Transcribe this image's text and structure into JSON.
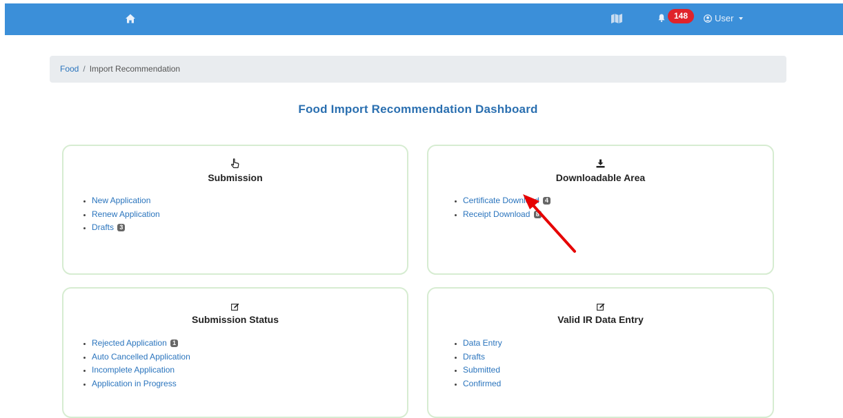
{
  "topbar": {
    "notification_count": "148",
    "user_label": "User",
    "bg_color": "#3b8fd9",
    "badge_color": "#e0232b"
  },
  "breadcrumb": {
    "root": "Food",
    "separator": "/",
    "current": "Import Recommendation"
  },
  "page": {
    "title": "Food Import Recommendation Dashboard"
  },
  "cards": {
    "submission": {
      "icon": "hand-pointer-icon",
      "title": "Submission",
      "items": [
        {
          "label": "New Application",
          "count": ""
        },
        {
          "label": "Renew Application",
          "count": ""
        },
        {
          "label": "Drafts",
          "count": "3"
        }
      ]
    },
    "downloadable": {
      "icon": "download-icon",
      "title": "Downloadable Area",
      "items": [
        {
          "label": "Certificate Download",
          "count": "4"
        },
        {
          "label": "Receipt Download",
          "count": "8"
        }
      ]
    },
    "status": {
      "icon": "edit-icon",
      "title": "Submission Status",
      "items": [
        {
          "label": "Rejected Application",
          "count": "1"
        },
        {
          "label": "Auto Cancelled Application",
          "count": ""
        },
        {
          "label": "Incomplete Application",
          "count": ""
        },
        {
          "label": "Application in Progress",
          "count": ""
        }
      ]
    },
    "ir_entry": {
      "icon": "edit-icon",
      "title": "Valid IR Data Entry",
      "items": [
        {
          "label": "Data Entry",
          "count": ""
        },
        {
          "label": "Drafts",
          "count": ""
        },
        {
          "label": "Submitted",
          "count": ""
        },
        {
          "label": "Confirmed",
          "count": ""
        }
      ]
    }
  },
  "annotation": {
    "arrow_color": "#e60000"
  }
}
